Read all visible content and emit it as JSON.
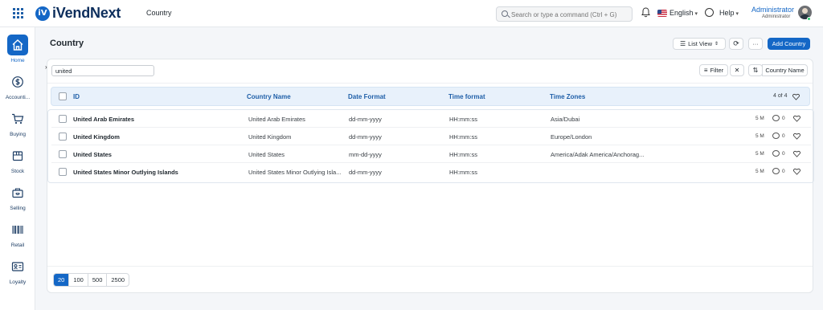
{
  "app": {
    "name": "iVendNext",
    "logo_letter": "iV"
  },
  "breadcrumb": "Country",
  "search": {
    "placeholder": "Search or type a command (Ctrl + G)"
  },
  "language": "English",
  "help": "Help",
  "user": {
    "name": "Administrator",
    "role": "Administrator"
  },
  "sidebar": {
    "items": [
      {
        "label": "Home",
        "icon": "home-icon"
      },
      {
        "label": "Accounti...",
        "icon": "dollar-icon"
      },
      {
        "label": "Buying",
        "icon": "cart-icon"
      },
      {
        "label": "Stock",
        "icon": "box-icon"
      },
      {
        "label": "Selling",
        "icon": "selling-icon"
      },
      {
        "label": "Retail",
        "icon": "barcode-icon"
      },
      {
        "label": "Loyalty",
        "icon": "id-card-icon"
      }
    ]
  },
  "page": {
    "title": "Country",
    "list_view_label": "List View",
    "more_label": "···",
    "add_label": "Add Country"
  },
  "filters": {
    "search_value": "united",
    "filter_label": "Filter",
    "sort_label": "Country Name"
  },
  "table": {
    "headers": {
      "id": "ID",
      "country_name": "Country Name",
      "date_format": "Date Format",
      "time_format": "Time format",
      "time_zones": "Time Zones"
    },
    "count": "4 of 4",
    "rows": [
      {
        "id": "United Arab Emirates",
        "country_name": "United Arab Emirates",
        "date_format": "dd-mm-yyyy",
        "time_format": "HH:mm:ss",
        "time_zones": "Asia/Dubai",
        "modified": "5 M",
        "comments": "0"
      },
      {
        "id": "United Kingdom",
        "country_name": "United Kingdom",
        "date_format": "dd-mm-yyyy",
        "time_format": "HH:mm:ss",
        "time_zones": "Europe/London",
        "modified": "5 M",
        "comments": "0"
      },
      {
        "id": "United States",
        "country_name": "United States",
        "date_format": "mm-dd-yyyy",
        "time_format": "HH:mm:ss",
        "time_zones": "America/Adak America/Anchorag...",
        "modified": "5 M",
        "comments": "0"
      },
      {
        "id": "United States Minor Outlying Islands",
        "country_name": "United States Minor Outlying Isla...",
        "date_format": "dd-mm-yyyy",
        "time_format": "HH:mm:ss",
        "time_zones": "",
        "modified": "5 M",
        "comments": "0"
      }
    ]
  },
  "paging": {
    "options": [
      "20",
      "100",
      "500",
      "2500"
    ],
    "selected": "20"
  },
  "colors": {
    "accent": "#1467c6",
    "header_bg": "#e8f1fb"
  }
}
